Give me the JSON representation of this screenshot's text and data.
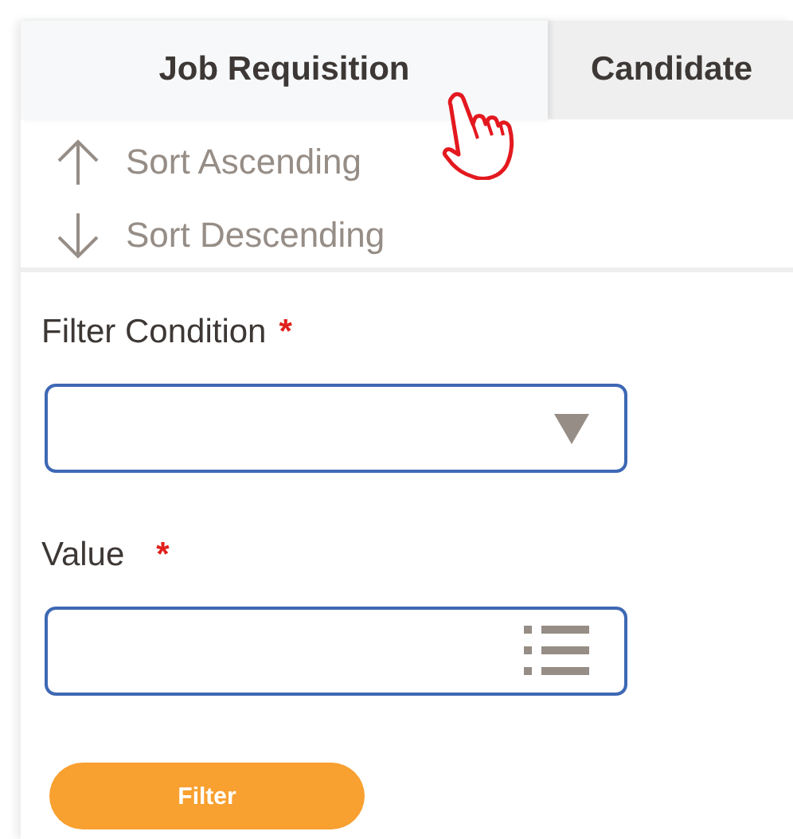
{
  "tabs": [
    {
      "label": "Job Requisition",
      "selected": true
    },
    {
      "label": "Candidate",
      "selected": false
    }
  ],
  "sort_menu": [
    {
      "label": "Sort Ascending",
      "kind": "ascending"
    },
    {
      "label": "Sort Descending",
      "kind": "descending"
    }
  ],
  "fields": [
    {
      "label": "Filter Condition",
      "required_mark": "*",
      "kind": "dropdown"
    },
    {
      "label": "Value",
      "required_mark": "*",
      "kind": "list"
    }
  ],
  "button": "Filter"
}
